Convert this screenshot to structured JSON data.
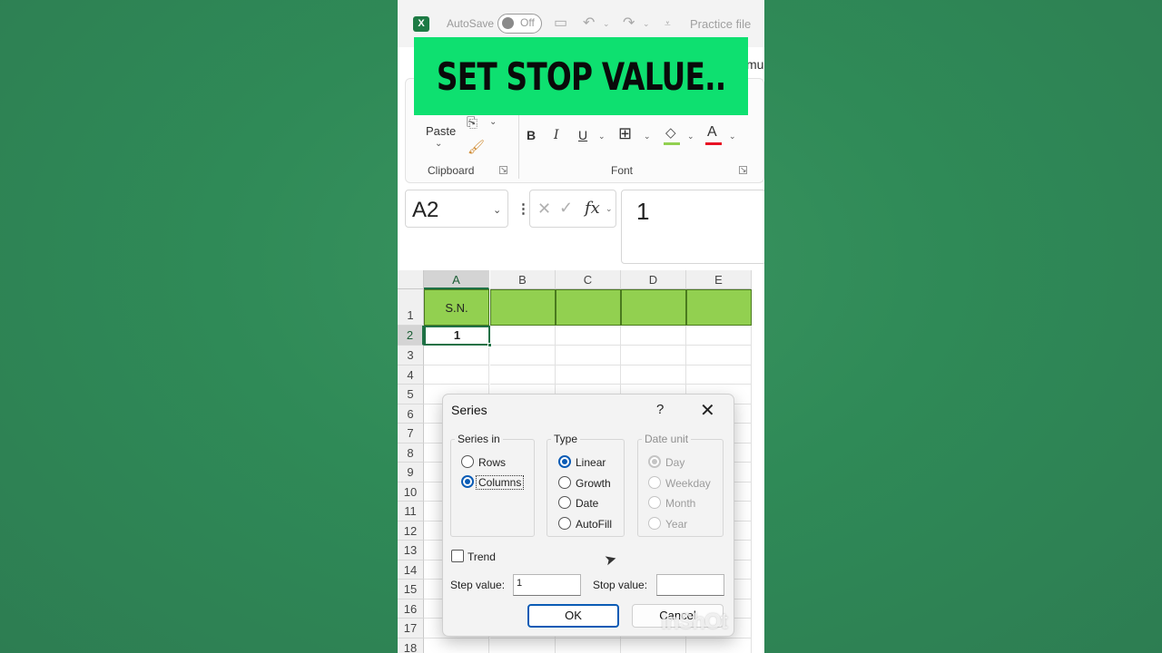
{
  "titlebar": {
    "app_icon": "excel-logo-icon",
    "autosave_label": "AutoSave",
    "toggle_state": "Off",
    "file_name": "Practice file"
  },
  "banner": {
    "text": "SET STOP VALUE.."
  },
  "ribbon": {
    "tab_fragment": "mu",
    "paste_label": "Paste",
    "clipboard_group": "Clipboard",
    "font_group": "Font",
    "bold": "B",
    "italic": "I",
    "underline": "U",
    "fill_color": "#92d050",
    "font_color": "#e81123"
  },
  "formula_bar": {
    "name_box": "A2",
    "fx_label": "fx",
    "formula_value": "1"
  },
  "grid": {
    "columns": [
      "A",
      "B",
      "C",
      "D",
      "E"
    ],
    "rows": [
      "1",
      "2",
      "3",
      "4",
      "5",
      "6",
      "7",
      "8",
      "9",
      "10",
      "11",
      "12",
      "13",
      "14",
      "15",
      "16",
      "17",
      "18"
    ],
    "header_cell": "S.N.",
    "a2_value": "1",
    "header_fill": "#92d050"
  },
  "dialog": {
    "title": "Series",
    "help": "?",
    "close": "✕",
    "series_in": {
      "legend": "Series in",
      "options": [
        {
          "label": "Rows",
          "selected": false
        },
        {
          "label": "Columns",
          "selected": true
        }
      ]
    },
    "type": {
      "legend": "Type",
      "options": [
        {
          "label": "Linear",
          "selected": true
        },
        {
          "label": "Growth",
          "selected": false
        },
        {
          "label": "Date",
          "selected": false
        },
        {
          "label": "AutoFill",
          "selected": false
        }
      ]
    },
    "date_unit": {
      "legend": "Date unit",
      "enabled": false,
      "options": [
        {
          "label": "Day",
          "selected": true
        },
        {
          "label": "Weekday",
          "selected": false
        },
        {
          "label": "Month",
          "selected": false
        },
        {
          "label": "Year",
          "selected": false
        }
      ]
    },
    "trend_label": "Trend",
    "trend_checked": false,
    "step_label": "Step value:",
    "step_value": "1",
    "stop_label": "Stop value:",
    "stop_value": "",
    "ok_label": "OK",
    "cancel_label": "Cancel"
  },
  "watermark": "InShOt"
}
